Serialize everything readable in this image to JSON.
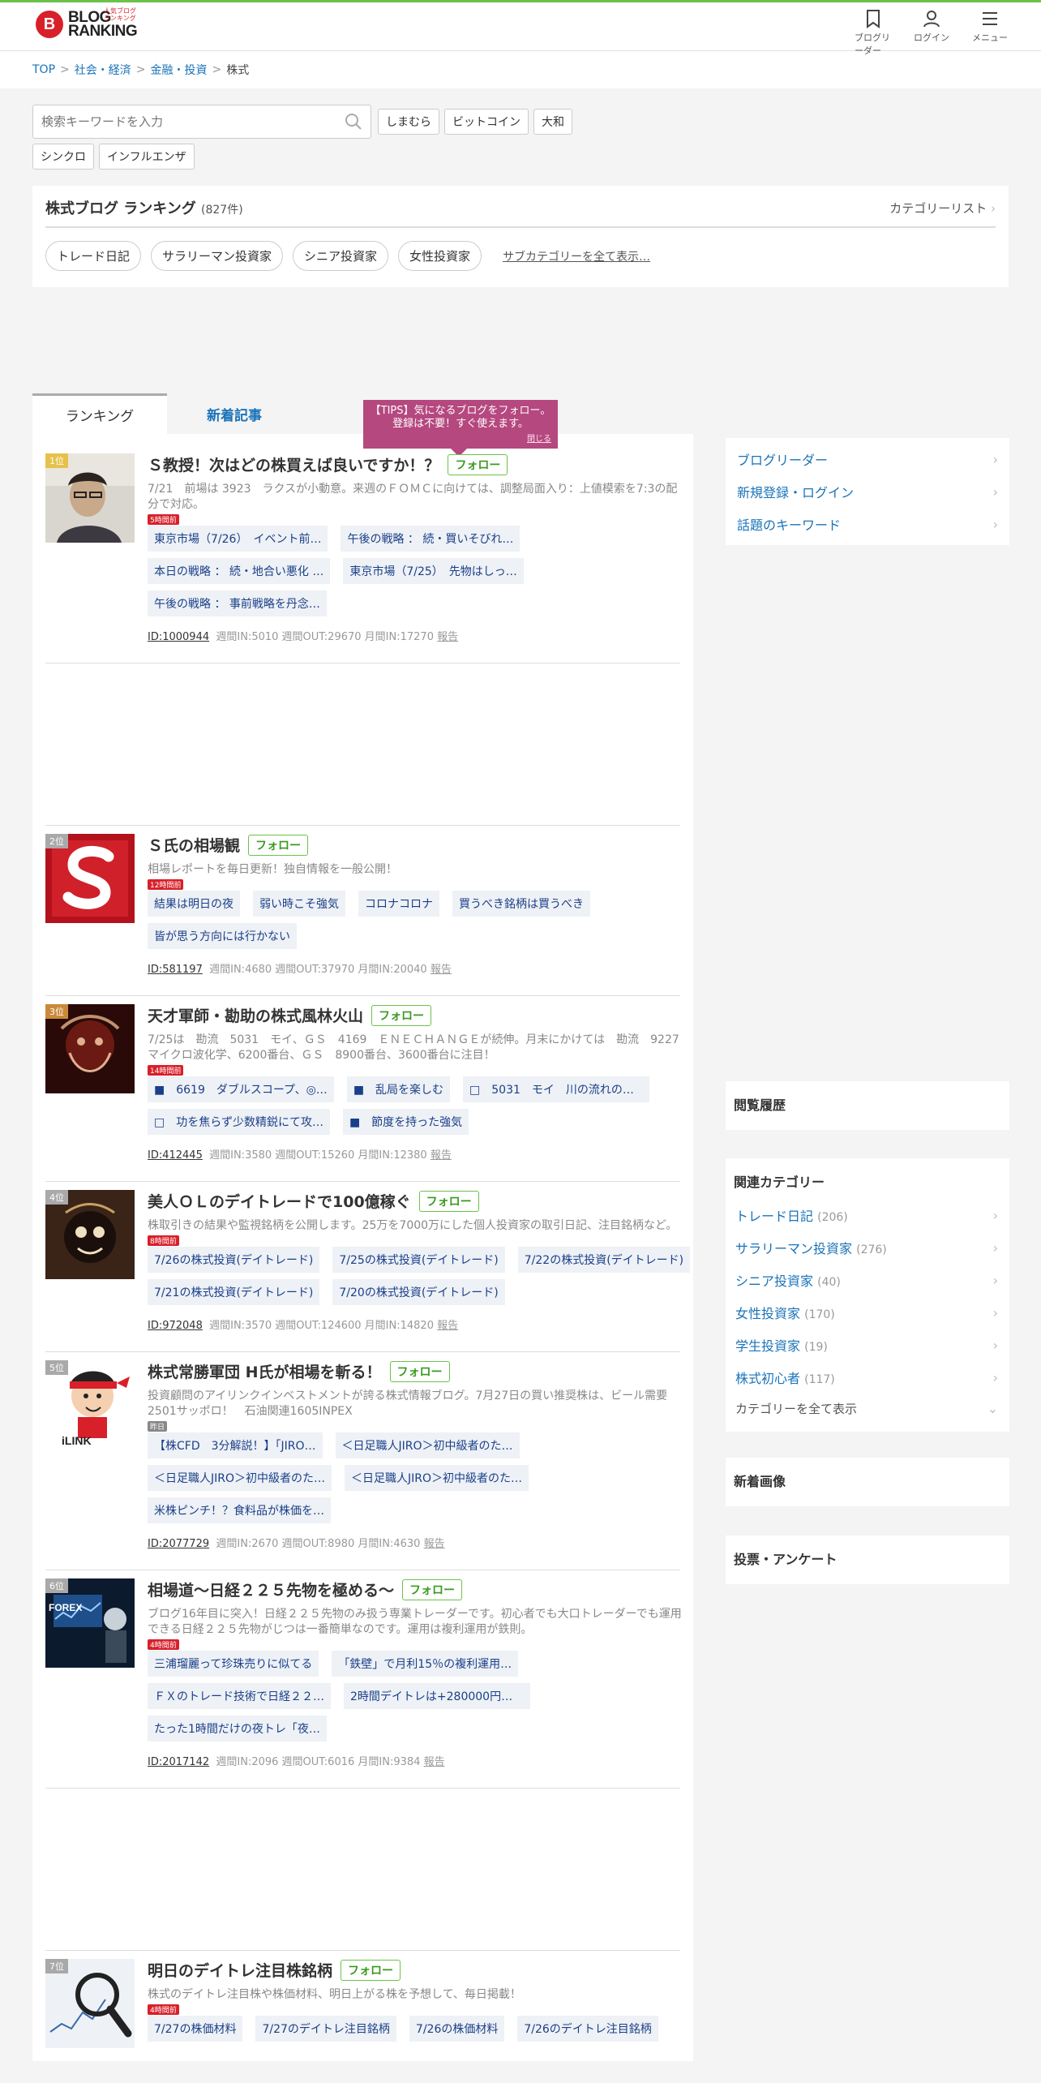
{
  "header": {
    "logo_mark": "B",
    "logo_line1": "BLOG",
    "logo_line2": "RANKING",
    "logo_sub": "人気ブログランキング",
    "nav": [
      {
        "label": "ブログリーダー",
        "icon": "bookmark-icon"
      },
      {
        "label": "ログイン",
        "icon": "user-icon"
      },
      {
        "label": "メニュー",
        "icon": "hamburger-icon"
      }
    ]
  },
  "breadcrumb": [
    "TOP",
    "社会・経済",
    "金融・投資",
    "株式"
  ],
  "search": {
    "placeholder": "検索キーワードを入力",
    "keywords": [
      "しまむら",
      "ビットコイン",
      "大和",
      "シンクロ",
      "インフルエンザ"
    ]
  },
  "category": {
    "title": "株式ブログ ランキング",
    "count": "(827件)",
    "list_link": "カテゴリーリスト",
    "subcats": [
      "トレード日記",
      "サラリーマン投資家",
      "シニア投資家",
      "女性投資家"
    ],
    "show_all": "サブカテゴリーを全て表示…"
  },
  "tabs": {
    "ranking": "ランキング",
    "new_articles": "新着記事"
  },
  "tips": {
    "line1": "【TIPS】気になるブログをフォロー。",
    "line2": "登録は不要！すぐ使えます。",
    "close": "閉じる"
  },
  "follow_label": "フォロー",
  "entries": [
    {
      "rank": "1位",
      "title": "Ｓ教授！次はどの株買えば良いですか！？",
      "desc": "7/21　前場は 3923　ラクスが小動意。来週のＦＯＭＣに向けては、調整局面入り：上値模索を7:3の配分で対応。",
      "new": "5時間前",
      "articles": [
        "東京市場（7/26）　イベント前…",
        "午後の戦略 ： 続・買いそびれ…",
        "本日の戦略 ： 続・地合い悪化 …",
        "東京市場（7/25）　先物はしっ…",
        "午後の戦略 ： 事前戦略を丹念…"
      ],
      "id": "ID:1000944",
      "stats": "週間IN:5010 週間OUT:29670 月間IN:17270",
      "report": "報告"
    },
    {
      "rank": "2位",
      "title": "Ｓ氏の相場観",
      "desc": "相場レポートを毎日更新！独自情報を一般公開！",
      "new": "12時間前",
      "articles": [
        "結果は明日の夜",
        "弱い時こそ強気",
        "コロナコロナ",
        "買うべき銘柄は買うべき",
        "皆が思う方向には行かない"
      ],
      "id": "ID:581197",
      "stats": "週間IN:4680 週間OUT:37970 月間IN:20040",
      "report": "報告"
    },
    {
      "rank": "3位",
      "title": "天才軍師・勘助の株式風林火山",
      "desc": "7/25は　勘流　5031　モイ、ＧＳ　4169　ＥＮＥＣＨＡＮＧＥが続伸。月末にかけては　勘流　9227　マイクロ波化学、6200番台、ＧＳ　8900番台、3600番台に注目！",
      "new": "14時間前",
      "articles": [
        "■　6619　ダブルスコープ、◎…",
        "■　乱局を楽しむ",
        "□　5031　モイ　川の流れのよ…",
        "□　功を焦らず少数精鋭にて攻…",
        "■　節度を持った強気"
      ],
      "id": "ID:412445",
      "stats": "週間IN:3580 週間OUT:15260 月間IN:12380",
      "report": "報告"
    },
    {
      "rank": "4位",
      "title": "美人ＯＬのデイトレードで100億稼ぐ",
      "desc": "株取引きの結果や監視銘柄を公開します。25万を7000万にした個人投資家の取引日記、注目銘柄など。",
      "new": "8時間前",
      "articles": [
        "7/26の株式投資(デイトレード)",
        "7/25の株式投資(デイトレード)",
        "7/22の株式投資(デイトレード)",
        "7/21の株式投資(デイトレード)",
        "7/20の株式投資(デイトレード)"
      ],
      "id": "ID:972048",
      "stats": "週間IN:3570 週間OUT:124600 月間IN:14820",
      "report": "報告"
    },
    {
      "rank": "5位",
      "title": "株式常勝軍団 H氏が相場を斬る！",
      "desc": "投資顧問のアイリンクインベストメントが誇る株式情報ブログ。7月27日の買い推奨株は、ビール需要2501サッポロ！　石油関連1605INPEX",
      "new": "昨日",
      "articles": [
        "【株CFD　3分解説！】「JIRO…",
        "＜日足職人JIRO＞初中級者のた…",
        "＜日足職人JIRO＞初中級者のた…",
        "＜日足職人JIRO＞初中級者のた…",
        "米株ピンチ！？食料品が株価を…"
      ],
      "id": "ID:2077729",
      "stats": "週間IN:2670 週間OUT:8980 月間IN:4630",
      "report": "報告"
    },
    {
      "rank": "6位",
      "title": "相場道〜日経２２５先物を極める〜",
      "desc": "ブログ16年目に突入！日経２２５先物のみ扱う専業トレーダーです。初心者でも大口トレーダーでも運用できる日経２２５先物がじつは一番簡単なのです。運用は複利運用が鉄則。",
      "new": "4時間前",
      "articles": [
        "三浦瑠麗って珍珠売りに似てる",
        "「鉄壁」で月利15％の複利運用…",
        "ＦＸのトレード技術で日経２２…",
        "2時間デイトレは+280000円と-…",
        "たった1時間だけの夜トレ「夜…"
      ],
      "id": "ID:2017142",
      "stats": "週間IN:2096 週間OUT:6016 月間IN:9384",
      "report": "報告"
    },
    {
      "rank": "7位",
      "title": "明日のデイトレ注目株銘柄",
      "desc": "株式のデイトレ注目株や株価材料、明日上がる株を予想して、毎日掲載！",
      "new": "4時間前",
      "articles": [
        "7/27の株価材料",
        "7/27のデイトレ注目銘柄",
        "7/26の株価材料",
        "7/26のデイトレ注目銘柄"
      ],
      "id": "",
      "stats": "",
      "report": ""
    }
  ],
  "sidebar": {
    "links": [
      "ブログリーダー",
      "新規登録・ログイン",
      "話題のキーワード"
    ],
    "history_title": "閲覧履歴",
    "related_title": "関連カテゴリー",
    "related": [
      {
        "name": "トレード日記",
        "count": "(206)"
      },
      {
        "name": "サラリーマン投資家",
        "count": "(276)"
      },
      {
        "name": "シニア投資家",
        "count": "(40)"
      },
      {
        "name": "女性投資家",
        "count": "(170)"
      },
      {
        "name": "学生投資家",
        "count": "(19)"
      },
      {
        "name": "株式初心者",
        "count": "(117)"
      }
    ],
    "show_all_categories": "カテゴリーを全て表示",
    "new_images_title": "新着画像",
    "vote_title": "投票・アンケート"
  },
  "colors": {
    "accent_green": "#6cc24a",
    "link_blue": "#1a73b8",
    "tips_pink": "#b5487f",
    "rank_gold": "#e6c14b"
  }
}
